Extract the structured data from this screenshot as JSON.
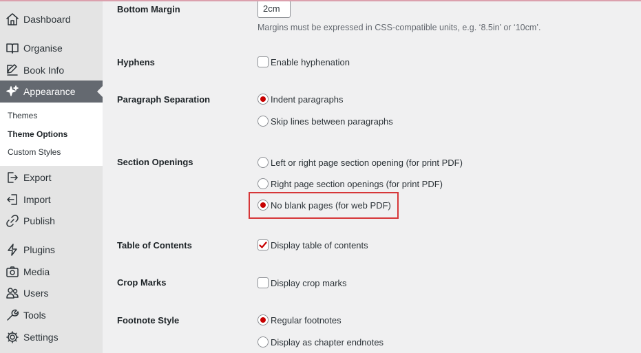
{
  "sidebar": {
    "items": [
      {
        "label": "Dashboard",
        "icon": "home-icon"
      },
      {
        "label": "Organise",
        "icon": "book-icon"
      },
      {
        "label": "Book Info",
        "icon": "edit-icon"
      },
      {
        "label": "Appearance",
        "icon": "sparkles-icon"
      },
      {
        "label": "Export",
        "icon": "export-icon"
      },
      {
        "label": "Import",
        "icon": "import-icon"
      },
      {
        "label": "Publish",
        "icon": "link-icon"
      },
      {
        "label": "Plugins",
        "icon": "bolt-icon"
      },
      {
        "label": "Media",
        "icon": "camera-icon"
      },
      {
        "label": "Users",
        "icon": "users-icon"
      },
      {
        "label": "Tools",
        "icon": "wrench-icon"
      },
      {
        "label": "Settings",
        "icon": "gear-icon"
      }
    ],
    "submenu": [
      "Themes",
      "Theme Options",
      "Custom Styles"
    ]
  },
  "form": {
    "bottom_margin": {
      "label": "Bottom Margin",
      "value": "2cm",
      "description": "Margins must be expressed in CSS-compatible units, e.g. ‘8.5in’ or ‘10cm’."
    },
    "hyphens": {
      "label": "Hyphens",
      "option": "Enable hyphenation",
      "checked": false
    },
    "paragraph_separation": {
      "label": "Paragraph Separation",
      "options": [
        "Indent paragraphs",
        "Skip lines between paragraphs"
      ],
      "selected": "Indent paragraphs"
    },
    "section_openings": {
      "label": "Section Openings",
      "options": [
        "Left or right page section opening (for print PDF)",
        "Right page section openings (for print PDF)",
        "No blank pages (for web PDF)"
      ],
      "selected": "No blank pages (for web PDF)"
    },
    "table_of_contents": {
      "label": "Table of Contents",
      "option": "Display table of contents",
      "checked": true
    },
    "crop_marks": {
      "label": "Crop Marks",
      "option": "Display crop marks",
      "checked": false
    },
    "footnote_style": {
      "label": "Footnote Style",
      "options": [
        "Regular footnotes",
        "Display as chapter endnotes"
      ],
      "selected": "Regular footnotes"
    }
  },
  "colors": {
    "accent": "#c70000",
    "highlight_box": "#d63638",
    "sidebar_active": "#646970"
  }
}
